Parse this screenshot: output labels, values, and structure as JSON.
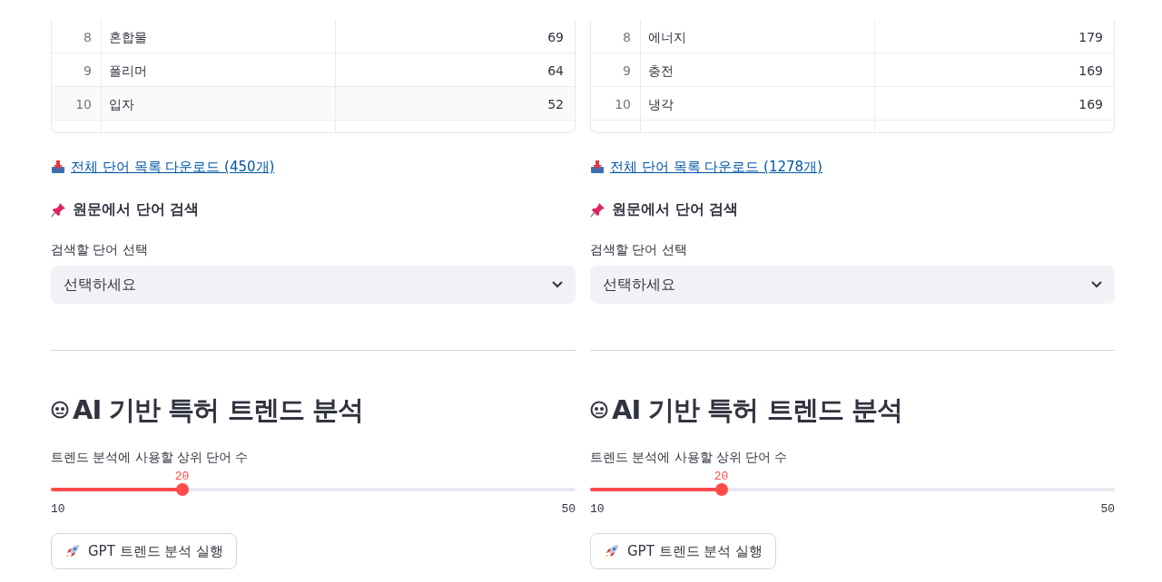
{
  "panels": [
    {
      "table": {
        "rows": [
          {
            "index": "8",
            "word": "혼합물",
            "count": "69"
          },
          {
            "index": "9",
            "word": "폴리머",
            "count": "64"
          },
          {
            "index": "10",
            "word": "입자",
            "count": "52"
          }
        ]
      },
      "download_link": "전체 단어 목록 다운로드 (450개)",
      "search_heading": "원문에서 단어 검색",
      "select": {
        "label": "검색할 단어 선택",
        "value": "선택하세요"
      },
      "trend_heading": "AI 기반 특허 트렌드 분석",
      "slider": {
        "label": "트렌드 분석에 사용할 상위 단어 수",
        "value": "20",
        "level": 0.25,
        "min": "10",
        "max": "50"
      },
      "button": "GPT 트렌드 분석 실행"
    },
    {
      "table": {
        "rows": [
          {
            "index": "8",
            "word": "에너지",
            "count": "179"
          },
          {
            "index": "9",
            "word": "충전",
            "count": "169"
          },
          {
            "index": "10",
            "word": "냉각",
            "count": "169"
          }
        ]
      },
      "download_link": "전체 단어 목록 다운로드 (1278개)",
      "search_heading": "원문에서 단어 검색",
      "select": {
        "label": "검색할 단어 선택",
        "value": "선택하세요"
      },
      "trend_heading": "AI 기반 특허 트렌드 분석",
      "slider": {
        "label": "트렌드 분석에 사용할 상위 단어 수",
        "value": "20",
        "level": 0.25,
        "min": "10",
        "max": "50"
      },
      "button": "GPT 트렌드 분석 실행"
    }
  ]
}
